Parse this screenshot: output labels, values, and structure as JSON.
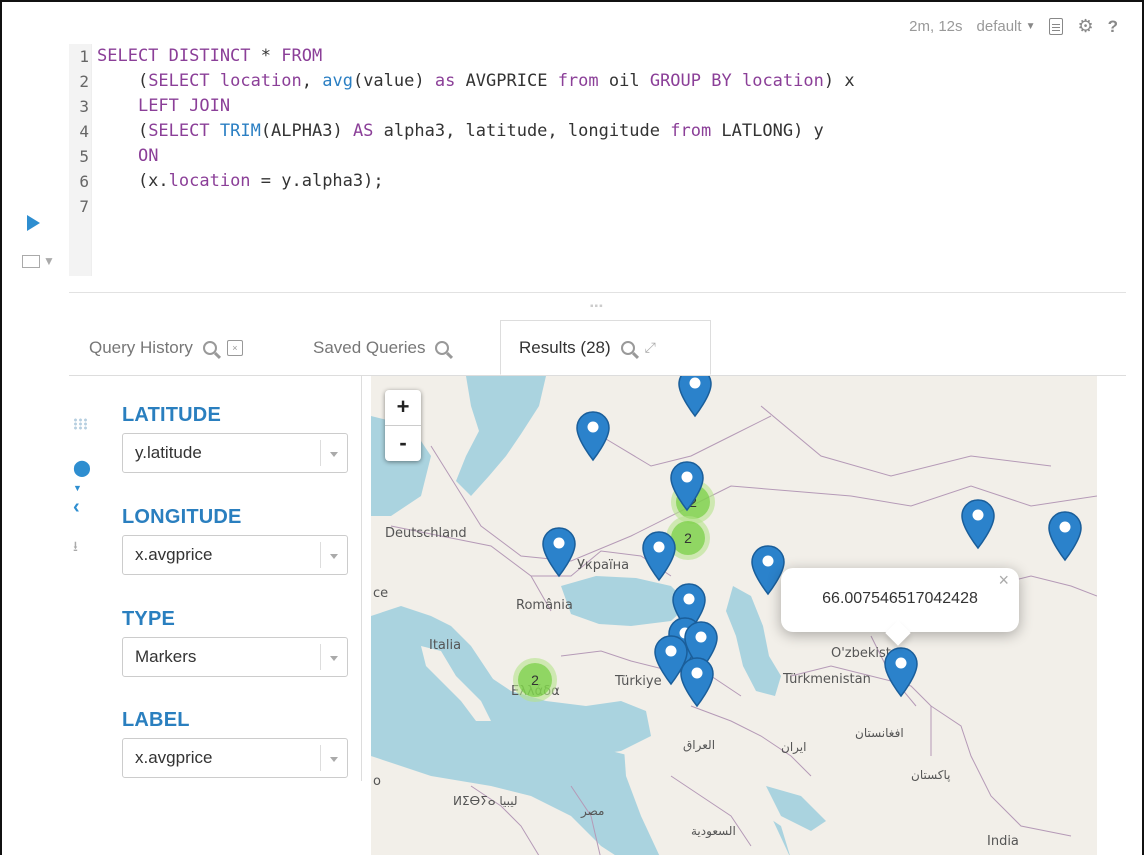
{
  "toolbar": {
    "duration": "2m, 12s",
    "database": "default"
  },
  "editor": {
    "line_numbers": [
      "1",
      "2",
      "3",
      "4",
      "5",
      "6",
      "7"
    ]
  },
  "tabs": {
    "query_history": "Query History",
    "saved_queries": "Saved Queries",
    "results": "Results (28)"
  },
  "chart_settings": {
    "latitude": {
      "label": "LATITUDE",
      "value": "y.latitude"
    },
    "longitude": {
      "label": "LONGITUDE",
      "value": "x.avgprice"
    },
    "type": {
      "label": "TYPE",
      "value": "Markers"
    },
    "label": {
      "label": "LABEL",
      "value": "x.avgprice"
    }
  },
  "map": {
    "zoom_in": "+",
    "zoom_out": "-",
    "labels": {
      "deutschland": "Deutschland",
      "ukraina": "Україна",
      "romania": "România",
      "italia": "Italia",
      "ellada": "Ελλάδα",
      "turkiye": "Türkiye",
      "ozbekiston": "O'zbekiston",
      "turkmenistan": "Türkmenistan",
      "afghanistan": "افغانستان",
      "iran": "ایران",
      "iraq": "العراق",
      "pakistan": "پاکستان",
      "libya": "ⵍⵉⴱⵢⴰ ليبيا",
      "egypt": "مصر",
      "saudi": "السعودية",
      "india": "India",
      "ce": "ce",
      "o": "o"
    },
    "clusters": [
      "2",
      "2",
      "2"
    ],
    "popup_value": "66.007546517042428",
    "popup_close": "×"
  }
}
